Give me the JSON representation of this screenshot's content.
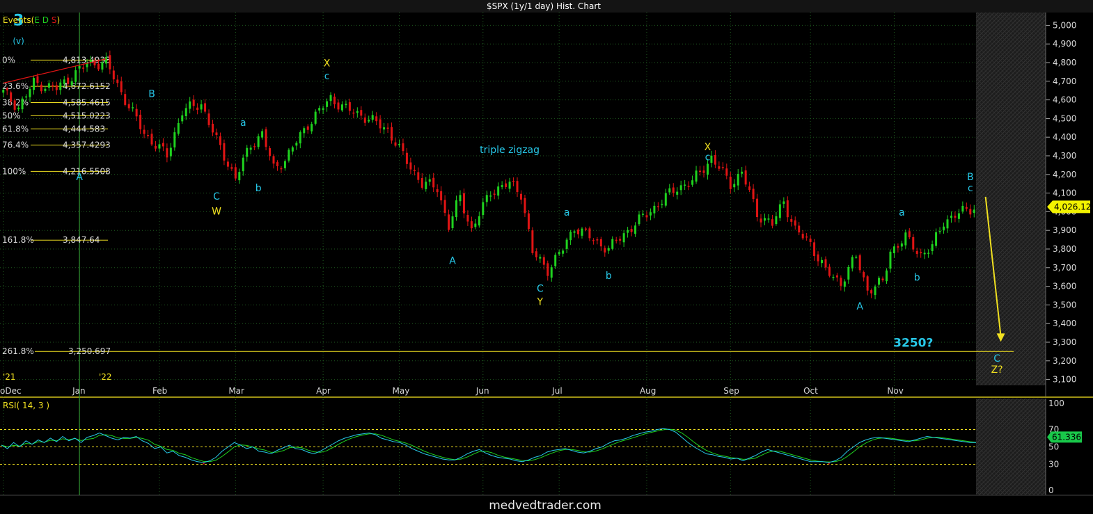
{
  "window": {
    "title": "$SPX (1y/1 day) Hist. Chart"
  },
  "header": {
    "events_label": "Events(",
    "events_e": "E",
    "events_d": "D",
    "events_s": "S",
    "events_close": ")"
  },
  "colors": {
    "background": "#000000",
    "grid": "#1f5a1f",
    "up": "#1fd21f",
    "down": "#e01414",
    "cyan": "#27c8e8",
    "yellow": "#f0e020",
    "text": "#d8d8d8",
    "price_tag": "#f2f200",
    "rsi_tag": "#19c84a"
  },
  "chart_data": [
    {
      "type": "candlestick",
      "title": "$SPX (1y/1 day) Hist. Chart",
      "ylim": [
        3050,
        5050
      ],
      "y_ticks": [
        "5,000",
        "4,900",
        "4,800",
        "4,700",
        "4,600",
        "4,500",
        "4,400",
        "4,300",
        "4,200",
        "4,100",
        "4,000",
        "3,900",
        "3,800",
        "3,700",
        "3,600",
        "3,500",
        "3,400",
        "3,300",
        "3,200",
        "3,100"
      ],
      "x_start_label": "o",
      "year_labels": [
        "'21",
        "'22"
      ],
      "months": [
        "Dec",
        "Jan",
        "Feb",
        "Mar",
        "Apr",
        "May",
        "Jun",
        "Jul",
        "Aug",
        "Sep",
        "Oct",
        "Nov"
      ],
      "last_price": "4,026.12",
      "fib_levels": [
        {
          "pct": "0%",
          "value": "4,813.4938",
          "price": 4813.49
        },
        {
          "pct": "23.6%",
          "value": "4,672.6152",
          "price": 4672.62
        },
        {
          "pct": "38.2%",
          "value": "4,585.4615",
          "price": 4585.46
        },
        {
          "pct": "50%",
          "value": "4,515.0223",
          "price": 4515.02
        },
        {
          "pct": "61.8%",
          "value": "4,444.583",
          "price": 4444.58
        },
        {
          "pct": "76.4%",
          "value": "4,357.4293",
          "price": 4357.43
        },
        {
          "pct": "100%",
          "value": "4,216.5508",
          "price": 4216.55
        },
        {
          "pct": "161.8%",
          "value": "3,847.64",
          "price": 3847.64
        },
        {
          "pct": "261.8%",
          "value": "3,250.697",
          "price": 3250.7
        }
      ],
      "annotations": [
        {
          "text": "3",
          "color": "cyan",
          "day": 4,
          "price": 5000,
          "size": 22
        },
        {
          "text": "(v)",
          "color": "cyan",
          "day": 4,
          "price": 4900,
          "size": 12
        },
        {
          "text": "A",
          "color": "cyan",
          "day": 20,
          "price": 4170,
          "size": 14
        },
        {
          "text": "B",
          "color": "cyan",
          "day": 39,
          "price": 4615,
          "size": 14
        },
        {
          "text": "C",
          "color": "cyan",
          "day": 56,
          "price": 4065,
          "size": 14
        },
        {
          "text": "W",
          "color": "yellow",
          "day": 56,
          "price": 3985,
          "size": 14
        },
        {
          "text": "a",
          "color": "cyan",
          "day": 63,
          "price": 4460,
          "size": 14
        },
        {
          "text": "b",
          "color": "cyan",
          "day": 67,
          "price": 4110,
          "size": 14
        },
        {
          "text": "X",
          "color": "yellow",
          "day": 85,
          "price": 4780,
          "size": 14
        },
        {
          "text": "c",
          "color": "cyan",
          "day": 85,
          "price": 4710,
          "size": 14
        },
        {
          "text": "triple zigzag",
          "color": "cyan",
          "day": 133,
          "price": 4315,
          "size": 14
        },
        {
          "text": "A",
          "color": "cyan",
          "day": 118,
          "price": 3720,
          "size": 14
        },
        {
          "text": "a",
          "color": "cyan",
          "day": 148,
          "price": 3980,
          "size": 14
        },
        {
          "text": "C",
          "color": "cyan",
          "day": 141,
          "price": 3570,
          "size": 14
        },
        {
          "text": "Y",
          "color": "yellow",
          "day": 141,
          "price": 3500,
          "size": 14
        },
        {
          "text": "b",
          "color": "cyan",
          "day": 159,
          "price": 3640,
          "size": 14
        },
        {
          "text": "X",
          "color": "yellow",
          "day": 185,
          "price": 4330,
          "size": 14
        },
        {
          "text": "c",
          "color": "cyan",
          "day": 185,
          "price": 4275,
          "size": 14
        },
        {
          "text": "A",
          "color": "cyan",
          "day": 225,
          "price": 3475,
          "size": 14
        },
        {
          "text": "a",
          "color": "cyan",
          "day": 236,
          "price": 3980,
          "size": 14
        },
        {
          "text": "b",
          "color": "cyan",
          "day": 240,
          "price": 3630,
          "size": 14
        },
        {
          "text": "B",
          "color": "cyan",
          "day": 254,
          "price": 4170,
          "size": 14
        },
        {
          "text": "c",
          "color": "cyan",
          "day": 254,
          "price": 4110,
          "size": 14
        },
        {
          "text": "3250?",
          "color": "cyan",
          "day": 239,
          "price": 3275,
          "size": 17
        },
        {
          "text": "C",
          "color": "cyan",
          "day": 261,
          "price": 3195,
          "size": 14
        },
        {
          "text": "Z?",
          "color": "yellow",
          "day": 261,
          "price": 3135,
          "size": 14
        }
      ],
      "arrow": {
        "from_day": 258,
        "from_price": 4080,
        "to_day": 262,
        "to_price": 3310,
        "color": "yellow"
      },
      "anchors": [
        {
          "day": 0,
          "price": 4640
        },
        {
          "day": 4,
          "price": 4560
        },
        {
          "day": 8,
          "price": 4690
        },
        {
          "day": 14,
          "price": 4660
        },
        {
          "day": 22,
          "price": 4795
        },
        {
          "day": 27,
          "price": 4800
        },
        {
          "day": 31,
          "price": 4640
        },
        {
          "day": 37,
          "price": 4420
        },
        {
          "day": 43,
          "price": 4300
        },
        {
          "day": 47,
          "price": 4540
        },
        {
          "day": 52,
          "price": 4580
        },
        {
          "day": 56,
          "price": 4380
        },
        {
          "day": 61,
          "price": 4180
        },
        {
          "day": 65,
          "price": 4360
        },
        {
          "day": 68,
          "price": 4420
        },
        {
          "day": 71,
          "price": 4230
        },
        {
          "day": 74,
          "price": 4280
        },
        {
          "day": 80,
          "price": 4470
        },
        {
          "day": 86,
          "price": 4610
        },
        {
          "day": 90,
          "price": 4550
        },
        {
          "day": 94,
          "price": 4520
        },
        {
          "day": 101,
          "price": 4440
        },
        {
          "day": 105,
          "price": 4300
        },
        {
          "day": 110,
          "price": 4150
        },
        {
          "day": 114,
          "price": 4130
        },
        {
          "day": 117,
          "price": 3920
        },
        {
          "day": 120,
          "price": 4080
        },
        {
          "day": 123,
          "price": 3900
        },
        {
          "day": 128,
          "price": 4110
        },
        {
          "day": 133,
          "price": 4150
        },
        {
          "day": 136,
          "price": 4100
        },
        {
          "day": 139,
          "price": 3780
        },
        {
          "day": 143,
          "price": 3690
        },
        {
          "day": 147,
          "price": 3800
        },
        {
          "day": 150,
          "price": 3920
        },
        {
          "day": 155,
          "price": 3850
        },
        {
          "day": 159,
          "price": 3800
        },
        {
          "day": 164,
          "price": 3900
        },
        {
          "day": 168,
          "price": 3970
        },
        {
          "day": 173,
          "price": 4060
        },
        {
          "day": 177,
          "price": 4130
        },
        {
          "day": 181,
          "price": 4160
        },
        {
          "day": 186,
          "price": 4290
        },
        {
          "day": 191,
          "price": 4150
        },
        {
          "day": 194,
          "price": 4210
        },
        {
          "day": 198,
          "price": 3990
        },
        {
          "day": 202,
          "price": 3930
        },
        {
          "day": 205,
          "price": 4060
        },
        {
          "day": 208,
          "price": 3900
        },
        {
          "day": 212,
          "price": 3830
        },
        {
          "day": 216,
          "price": 3680
        },
        {
          "day": 220,
          "price": 3620
        },
        {
          "day": 224,
          "price": 3760
        },
        {
          "day": 227,
          "price": 3580
        },
        {
          "day": 231,
          "price": 3620
        },
        {
          "day": 233,
          "price": 3790
        },
        {
          "day": 237,
          "price": 3860
        },
        {
          "day": 241,
          "price": 3770
        },
        {
          "day": 244,
          "price": 3810
        },
        {
          "day": 247,
          "price": 3950
        },
        {
          "day": 252,
          "price": 4000
        },
        {
          "day": 255,
          "price": 4026
        }
      ],
      "red_trendline": {
        "from_day": 0,
        "from_price": 4690,
        "to_day": 27,
        "to_price": 4820
      }
    },
    {
      "type": "line",
      "title": "RSI( 14, 3 )",
      "ylim": [
        0,
        100
      ],
      "y_ticks": [
        "100",
        "70",
        "50",
        "30",
        "0"
      ],
      "reference_lines": [
        70,
        50,
        30
      ],
      "last_value": "61.336",
      "series": [
        {
          "name": "RSI",
          "color": "cyan"
        },
        {
          "name": "signal",
          "color": "green"
        }
      ],
      "values": [
        52,
        48,
        55,
        50,
        57,
        53,
        58,
        55,
        60,
        56,
        62,
        57,
        60,
        55,
        61,
        63,
        66,
        63,
        60,
        58,
        61,
        60,
        62,
        57,
        54,
        48,
        50,
        43,
        45,
        40,
        38,
        35,
        33,
        32,
        34,
        38,
        45,
        50,
        55,
        52,
        48,
        50,
        45,
        44,
        42,
        46,
        49,
        52,
        48,
        47,
        44,
        42,
        45,
        49,
        53,
        57,
        60,
        62,
        64,
        65,
        66,
        64,
        60,
        58,
        56,
        55,
        52,
        48,
        45,
        42,
        40,
        38,
        36,
        35,
        35,
        38,
        42,
        45,
        47,
        43,
        40,
        38,
        37,
        36,
        34,
        33,
        35,
        38,
        40,
        44,
        46,
        47,
        48,
        46,
        44,
        43,
        45,
        48,
        50,
        54,
        57,
        58,
        60,
        63,
        65,
        67,
        68,
        70,
        71,
        70,
        67,
        61,
        55,
        50,
        46,
        42,
        41,
        39,
        38,
        36,
        37,
        34,
        37,
        40,
        44,
        47,
        45,
        43,
        41,
        39,
        37,
        35,
        33,
        33,
        33,
        32,
        34,
        38,
        45,
        50,
        55,
        58,
        60,
        61,
        60,
        59,
        58,
        57,
        56,
        58,
        60,
        62,
        61,
        60,
        59,
        58,
        57,
        56,
        55,
        55
      ]
    }
  ],
  "footer": {
    "watermark": "medvedtrader.com"
  }
}
